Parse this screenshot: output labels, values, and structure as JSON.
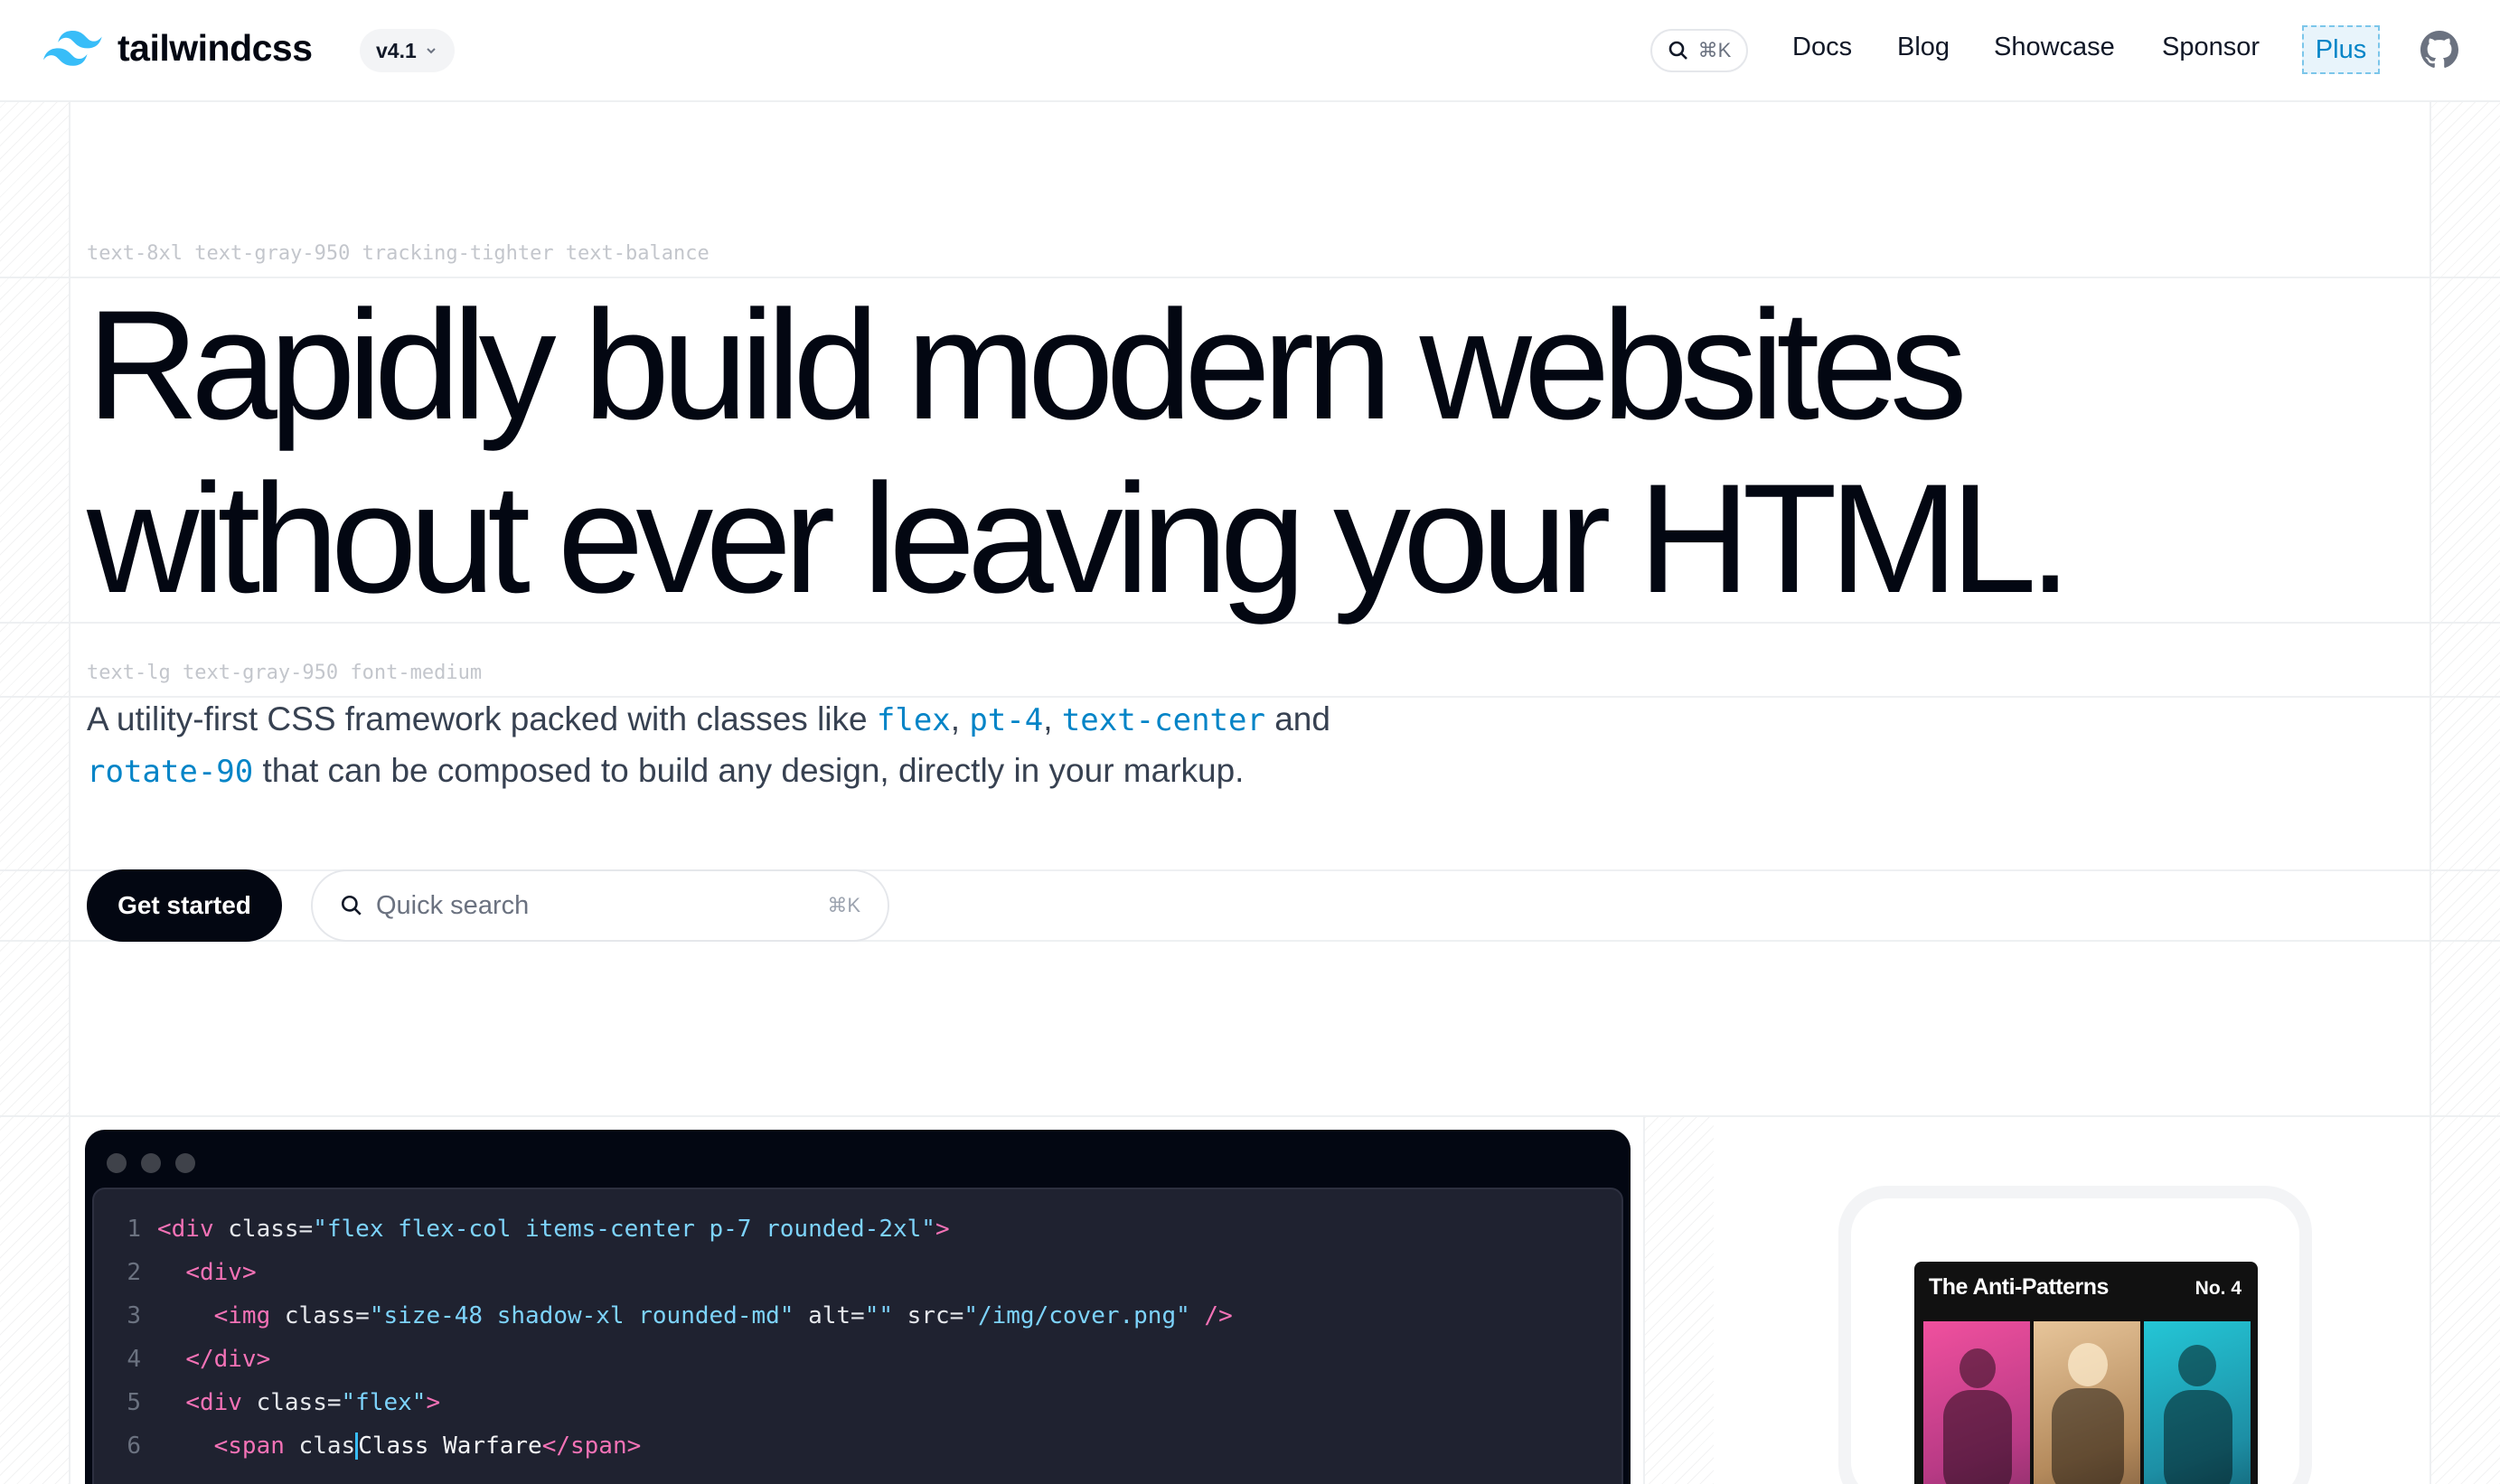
{
  "header": {
    "brand": "tailwindcss",
    "version": "v4.1",
    "search_shortcut": "⌘K",
    "nav": {
      "docs": "Docs",
      "blog": "Blog",
      "showcase": "Showcase",
      "sponsor": "Sponsor",
      "plus": "Plus"
    },
    "github_icon": "github-icon"
  },
  "hero": {
    "headline_label": "text-8xl text-gray-950 tracking-tighter text-balance",
    "headline_line1": "Rapidly build modern websites",
    "headline_line2": "without ever leaving your HTML.",
    "lede_label": "text-lg text-gray-950 font-medium",
    "lede_pre": "A utility-first CSS framework packed with classes like ",
    "lede_k1": "flex",
    "lede_sep1": ", ",
    "lede_k2": "pt-4",
    "lede_sep2": ", ",
    "lede_k3": "text-center",
    "lede_and": " and",
    "lede_k4": "rotate-90",
    "lede_post": " that can be composed to build any design, directly in your markup.",
    "cta_label": "Get started",
    "search_placeholder": "Quick search",
    "search_shortcut": "⌘K"
  },
  "code": {
    "lines": [
      {
        "n": "1",
        "indent": "",
        "open": "<div",
        "attr": " class=",
        "val": "\"flex flex-col items-center p-7 rounded-2xl\"",
        "rest": ">"
      },
      {
        "n": "2",
        "indent": "  ",
        "open": "<div",
        "attr": "",
        "val": "",
        "rest": ">"
      },
      {
        "n": "3",
        "indent": "    ",
        "open": "<img",
        "attr": " class=",
        "val": "\"size-48 shadow-xl rounded-md\"",
        "attr2": " alt=",
        "val2": "\"\"",
        "attr3": " src=",
        "val3": "\"/img/cover.png\"",
        "rest": " />"
      },
      {
        "n": "4",
        "indent": "  ",
        "open": "</div",
        "attr": "",
        "val": "",
        "rest": ">"
      },
      {
        "n": "5",
        "indent": "  ",
        "open": "<div",
        "attr": " class=",
        "val": "\"flex\"",
        "rest": ">"
      },
      {
        "n": "6",
        "indent": "    ",
        "open": "<span",
        "attr": " clas",
        "text": "Class Warfare",
        "close": "</span",
        "rest": ">"
      }
    ]
  },
  "preview": {
    "cover_title": "The Anti-Patterns",
    "cover_no": "No. 4"
  }
}
